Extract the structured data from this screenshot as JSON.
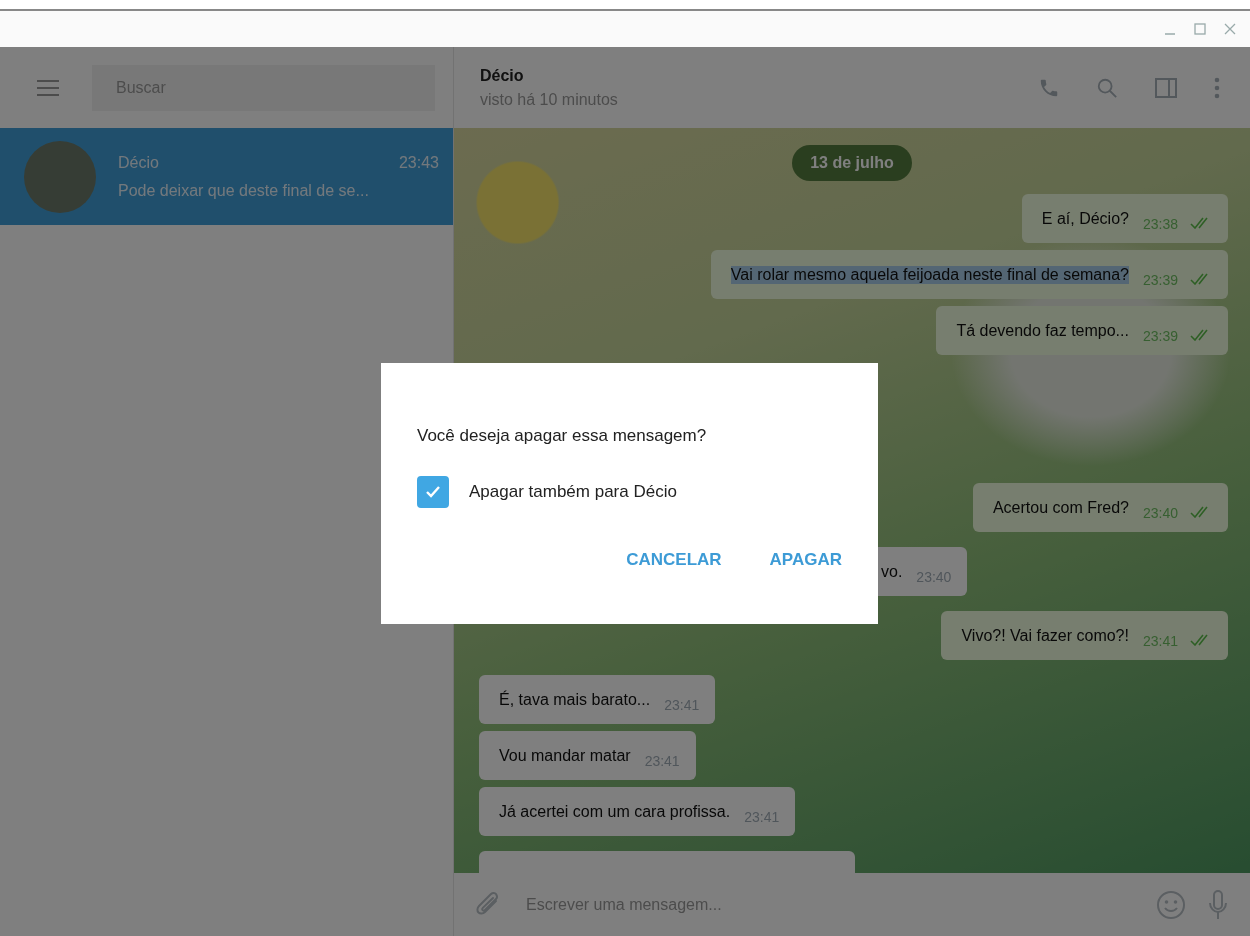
{
  "sidebar": {
    "search": {
      "placeholder": "Buscar"
    },
    "chats": [
      {
        "name": "Décio",
        "time": "23:43",
        "preview": "Pode deixar que deste final de se...",
        "selected": true
      }
    ]
  },
  "chat": {
    "name": "Décio",
    "status": "visto há 10 minutos",
    "date": "13 de julho",
    "messages": [
      {
        "kind": "outgoing",
        "text": "E aí, Décio?",
        "time": "23:38",
        "highlighted": false
      },
      {
        "kind": "outgoing",
        "text": "Vai rolar mesmo aquela feijoada neste final de semana?",
        "time": "23:39",
        "highlighted": true
      },
      {
        "kind": "outgoing",
        "text": "Tá devendo faz tempo...",
        "time": "23:39",
        "highlighted": false
      },
      {
        "kind": "outgoing",
        "text": "Acertou com Fred?",
        "time": "23:40",
        "highlighted": false
      },
      {
        "kind": "incoming_partial",
        "text": "vo.",
        "time": "23:40",
        "highlighted": false
      },
      {
        "kind": "outgoing",
        "text": "Vivo?! Vai fazer como?!",
        "time": "23:41",
        "highlighted": false
      },
      {
        "kind": "incoming",
        "text": "É, tava mais barato...",
        "time": "23:41",
        "highlighted": false
      },
      {
        "kind": "incoming",
        "text": "Vou mandar matar",
        "time": "23:41",
        "highlighted": false
      },
      {
        "kind": "incoming",
        "text": "Já acertei com um cara profissa.",
        "time": "23:41",
        "highlighted": false
      }
    ],
    "composer": {
      "placeholder": "Escrever uma mensagem..."
    }
  },
  "dialog": {
    "question": "Você deseja apagar essa mensagem?",
    "checkbox": {
      "label": "Apagar também para Décio",
      "checked": true
    },
    "buttons": [
      "CANCELAR",
      "APAGAR"
    ]
  }
}
